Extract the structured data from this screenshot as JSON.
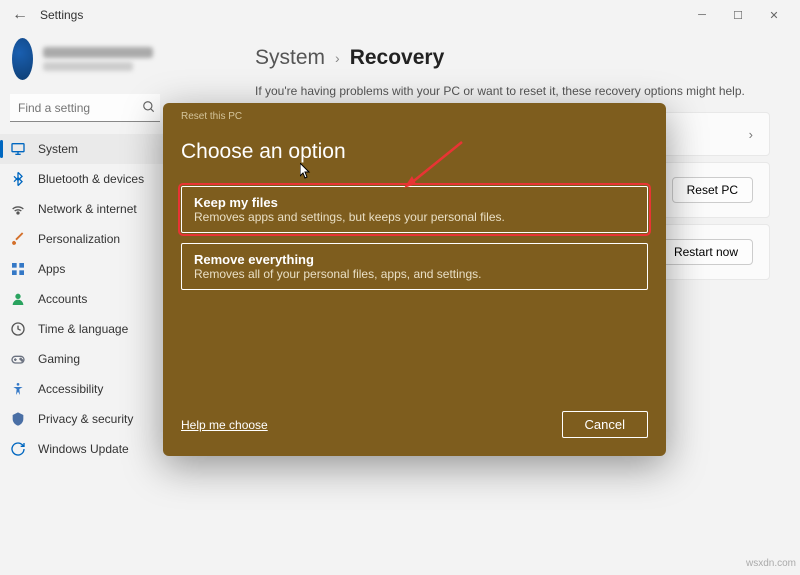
{
  "titlebar": {
    "back": "←",
    "title": "Settings"
  },
  "search": {
    "placeholder": "Find a setting"
  },
  "sidebar": {
    "items": [
      {
        "label": "System",
        "icon": "display-icon",
        "color": "#0067c0",
        "active": true
      },
      {
        "label": "Bluetooth & devices",
        "icon": "bluetooth-icon",
        "color": "#0067c0"
      },
      {
        "label": "Network & internet",
        "icon": "wifi-icon",
        "color": "#555"
      },
      {
        "label": "Personalization",
        "icon": "brush-icon",
        "color": "#d36f2a"
      },
      {
        "label": "Apps",
        "icon": "apps-icon",
        "color": "#3478c6"
      },
      {
        "label": "Accounts",
        "icon": "person-icon",
        "color": "#2aa35f"
      },
      {
        "label": "Time & language",
        "icon": "clock-icon",
        "color": "#555"
      },
      {
        "label": "Gaming",
        "icon": "gaming-icon",
        "color": "#6b7280"
      },
      {
        "label": "Accessibility",
        "icon": "accessibility-icon",
        "color": "#3478c6"
      },
      {
        "label": "Privacy & security",
        "icon": "shield-icon",
        "color": "#4a6fa5"
      },
      {
        "label": "Windows Update",
        "icon": "update-icon",
        "color": "#0067c0"
      }
    ]
  },
  "main": {
    "breadcrumb_parent": "System",
    "breadcrumb_current": "Recovery",
    "subtitle": "If you're having problems with your PC or want to reset it, these recovery options might help.",
    "rows": [
      {
        "action": "",
        "chevron": true
      },
      {
        "action": "Reset PC"
      },
      {
        "action": "Restart now"
      }
    ]
  },
  "dialog": {
    "top": "Reset this PC",
    "title": "Choose an option",
    "options": [
      {
        "title": "Keep my files",
        "desc": "Removes apps and settings, but keeps your personal files.",
        "highlight": true
      },
      {
        "title": "Remove everything",
        "desc": "Removes all of your personal files, apps, and settings."
      }
    ],
    "help": "Help me choose",
    "cancel": "Cancel"
  },
  "watermark": "wsxdn.com"
}
